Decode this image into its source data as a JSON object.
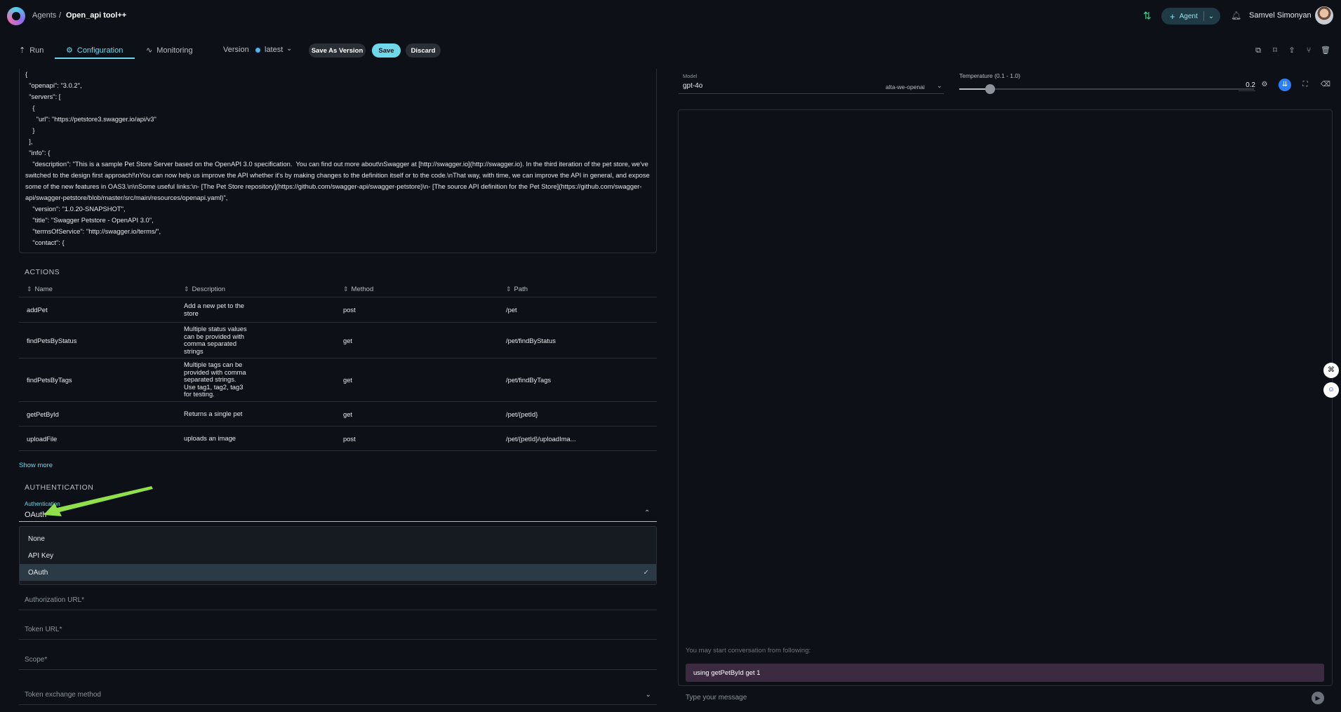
{
  "header": {
    "breadcrumb_root": "Agents",
    "breadcrumb_sep": "/",
    "breadcrumb_current": "Open_api tool++",
    "agent_button": "Agent",
    "user_name": "Samvel Simonyan"
  },
  "tabs": [
    {
      "label": "Run",
      "icon": "rocket-icon"
    },
    {
      "label": "Configuration",
      "icon": "gear-icon"
    },
    {
      "label": "Monitoring",
      "icon": "chart-icon"
    }
  ],
  "version": {
    "label": "Version",
    "value": "latest"
  },
  "buttons": {
    "save_as_version": "Save As Version",
    "save": "Save",
    "discard": "Discard"
  },
  "code_lines": [
    "{",
    "  \"openapi\": \"3.0.2\",",
    "  \"servers\": [",
    "    {",
    "      \"url\": \"https://petstore3.swagger.io/api/v3\"",
    "    }",
    "  ],",
    "  \"info\": {",
    "    \"description\": \"This is a sample Pet Store Server based on the OpenAPI 3.0 specification.  You can find out more about\\nSwagger at [http://swagger.io](http://swagger.io). In the third iteration of the pet store, we've switched to the design first approach!\\nYou can now help us improve the API whether it's by making changes to the definition itself or to the code.\\nThat way, with time, we can improve the API in general, and expose some of the new features in OAS3.\\n\\nSome useful links:\\n- [The Pet Store repository](https://github.com/swagger-api/swagger-petstore)\\n- [The source API definition for the Pet Store](https://github.com/swagger-api/swagger-petstore/blob/master/src/main/resources/openapi.yaml)\",",
    "    \"version\": \"1.0.20-SNAPSHOT\",",
    "    \"title\": \"Swagger Petstore - OpenAPI 3.0\",",
    "    \"termsOfService\": \"http://swagger.io/terms/\",",
    "    \"contact\": {"
  ],
  "actions": {
    "title": "ACTIONS",
    "columns": [
      "Name",
      "Description",
      "Method",
      "Path"
    ],
    "rows": [
      {
        "name": "addPet",
        "description": "Add a new pet to the store",
        "method": "post",
        "path": "/pet"
      },
      {
        "name": "findPetsByStatus",
        "description": "Multiple status values can be provided with comma separated strings",
        "method": "get",
        "path": "/pet/findByStatus"
      },
      {
        "name": "findPetsByTags",
        "description": "Multiple tags can be provided with comma separated strings. Use tag1, tag2, tag3 for testing.",
        "method": "get",
        "path": "/pet/findByTags"
      },
      {
        "name": "getPetById",
        "description": "Returns a single pet",
        "method": "get",
        "path": "/pet/{petId}"
      },
      {
        "name": "uploadFile",
        "description": "uploads an image",
        "method": "post",
        "path": "/pet/{petId}/uploadIma..."
      }
    ],
    "show_more": "Show more"
  },
  "authentication": {
    "title": "AUTHENTICATION",
    "label": "Authentication",
    "value": "OAuth",
    "options": [
      "None",
      "API Key",
      "OAuth"
    ],
    "selected_option": "OAuth",
    "fields": {
      "authorization_url": "Authorization URL*",
      "token_url": "Token URL*",
      "scope": "Scope*",
      "token_exchange_method": "Token exchange method"
    }
  },
  "model": {
    "label": "Model",
    "value": "gpt-4o",
    "provider": "alta-we-openai"
  },
  "temperature": {
    "label": "Temperature (0.1 - 1.0)",
    "value": "0.2",
    "level": 0.2
  },
  "chat": {
    "start_hint": "You may start conversation from following:",
    "suggestion": "using getPetById get 1",
    "input_placeholder": "Type your message"
  },
  "colors": {
    "accent": "#6fd7ea",
    "background": "#0d1117",
    "arrow": "#8fe04a"
  }
}
